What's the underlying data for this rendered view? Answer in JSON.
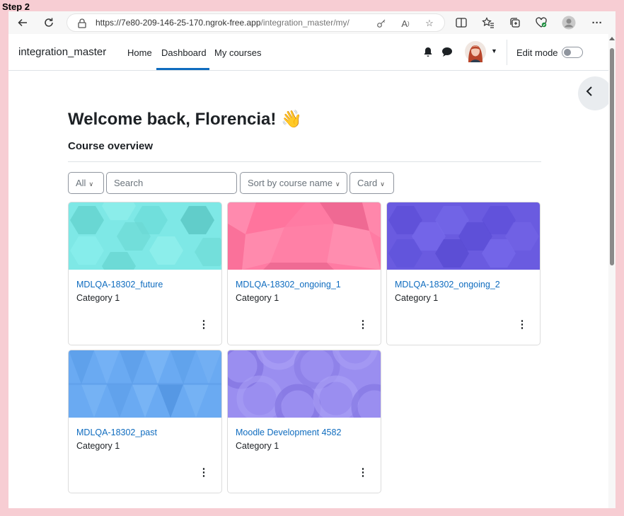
{
  "step_label": "Step 2",
  "browser": {
    "url_host": "https://7e80-209-146-25-170.ngrok-free.app",
    "url_path": "/integration_master/my/"
  },
  "navbar": {
    "brand": "integration_master",
    "links": [
      "Home",
      "Dashboard",
      "My courses"
    ],
    "active_link": "Dashboard",
    "edit_mode_label": "Edit mode",
    "edit_mode_on": false
  },
  "main": {
    "welcome": "Welcome back, Florencia! 👋",
    "overview_title": "Course overview",
    "filter_label": "All",
    "search_placeholder": "Search",
    "sort_label": "Sort by course name",
    "view_label": "Card"
  },
  "courses": [
    {
      "name": "MDLQA-18302_future",
      "category": "Category 1",
      "color": "#7ee8e6"
    },
    {
      "name": "MDLQA-18302_ongoing_1",
      "category": "Category 1",
      "color": "#ff7ba3"
    },
    {
      "name": "MDLQA-18302_ongoing_2",
      "category": "Category 1",
      "color": "#6a5be0"
    },
    {
      "name": "MDLQA-18302_past",
      "category": "Category 1",
      "color": "#6aaaf2"
    },
    {
      "name": "Moodle Development 4582",
      "category": "Category 1",
      "color": "#9a8ef0"
    }
  ],
  "colors": {
    "accent": "#0f6cbf",
    "text": "#1d2125",
    "frame": "#f7cdd3"
  },
  "icons": [
    "back-icon",
    "refresh-icon",
    "lock-icon",
    "key-icon",
    "read-aloud-icon",
    "favorite-icon",
    "split-screen-icon",
    "favorites-icon",
    "collections-icon",
    "health-icon",
    "profile-icon",
    "more-icon",
    "bell-icon",
    "chat-icon",
    "avatar",
    "chevron-down-icon",
    "chevron-left-icon",
    "kebab-icon"
  ]
}
